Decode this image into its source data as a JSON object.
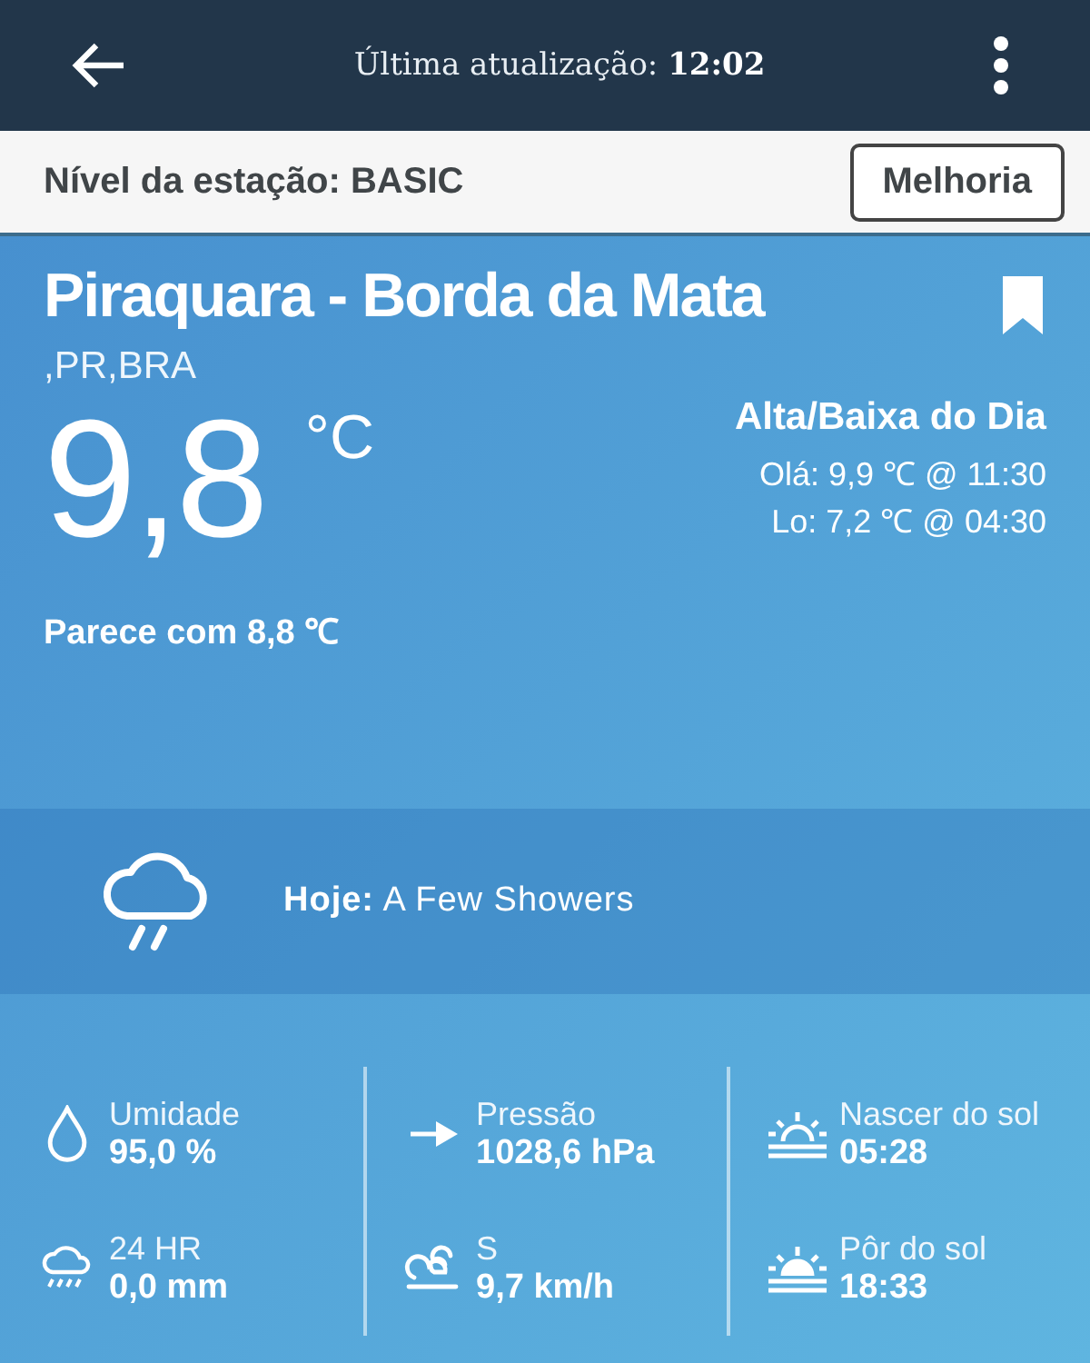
{
  "top_bar": {
    "label": "Última atualização:",
    "time": "12:02"
  },
  "station": {
    "level_text": "Nível da estação: BASIC",
    "upgrade_button": "Melhoria"
  },
  "location": {
    "name": "Piraquara - Borda da Mata",
    "region": ",PR,BRA",
    "bookmarked": true
  },
  "current": {
    "temperature": "9,8",
    "unit": "°C",
    "feels_like": "Parece com 8,8 ℃"
  },
  "high_low": {
    "title": "Alta/Baixa do Dia",
    "high": "Olá: 9,9 ℃ @ 11:30",
    "low": "Lo: 7,2 ℃ @ 04:30"
  },
  "forecast": {
    "label": "Hoje:",
    "text": "A Few Showers"
  },
  "stats": [
    {
      "kind": "drop",
      "label": "Umidade",
      "value": "95,0 %"
    },
    {
      "kind": "arrow",
      "label": "Pressão",
      "value": "1028,6 hPa"
    },
    {
      "kind": "sunrise",
      "label": "Nascer do sol",
      "value": "05:28"
    },
    {
      "kind": "rain",
      "label": "24 HR",
      "value": "0,0 mm"
    },
    {
      "kind": "wind",
      "label": "S",
      "value": "9,7 km/h"
    },
    {
      "kind": "sunset",
      "label": "Pôr do sol",
      "value": "18:33"
    }
  ]
}
